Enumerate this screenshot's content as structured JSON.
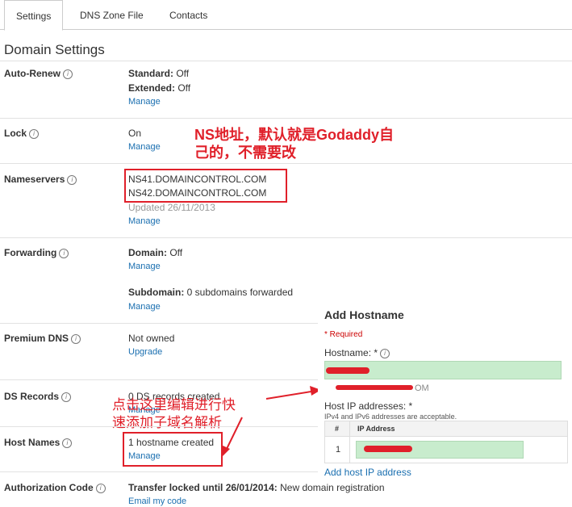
{
  "tabs": [
    "Settings",
    "DNS Zone File",
    "Contacts"
  ],
  "page_heading": "Domain Settings",
  "auto_renew": {
    "label": "Auto-Renew",
    "standard_label": "Standard:",
    "standard_value": " Off",
    "extended_label": "Extended:",
    "extended_value": " Off",
    "link": "Manage"
  },
  "lock": {
    "label": "Lock",
    "value": "On",
    "link": "Manage"
  },
  "nameservers": {
    "label": "Nameservers",
    "ns1": "NS41.DOMAINCONTROL.COM",
    "ns2": "NS42.DOMAINCONTROL.COM",
    "updated": "Updated 26/11/2013",
    "link": "Manage"
  },
  "forwarding": {
    "label": "Forwarding",
    "domain_label": "Domain:",
    "domain_value": " Off",
    "link1": "Manage",
    "subdomain_label": "Subdomain:",
    "subdomain_value": " 0 subdomains forwarded",
    "link2": "Manage"
  },
  "premium_dns": {
    "label": "Premium DNS",
    "value": "Not owned",
    "link": "Upgrade"
  },
  "ds_records": {
    "label": "DS Records",
    "value": "0 DS records created",
    "link": "Manage"
  },
  "host_names": {
    "label": "Host Names",
    "value": "1 hostname created",
    "link": "Manage"
  },
  "authorization": {
    "label": "Authorization Code",
    "value_bold": "Transfer locked until 26/01/2014:",
    "value_rest": " New domain registration",
    "link": "Email my code"
  },
  "annotations": {
    "ns_note_line1": "NS地址，默认就是Godaddy自",
    "ns_note_line2": "己的，不需要改",
    "host_note_line1": "点击这里编辑进行快",
    "host_note_line2": "速添加子域名解析"
  },
  "add_hostname": {
    "title": "Add Hostname",
    "required": "* Required",
    "hostname_label": "Hostname: *",
    "suffix_hint": "OM",
    "ip_label": "Host IP addresses: *",
    "ip_hint": "IPv4 and IPv6 addresses are acceptable.",
    "col_num": "#",
    "col_ip": "IP Address",
    "row_num": "1",
    "add_link": "Add host IP address"
  },
  "colors": {
    "accent_red": "#e0202a",
    "link_blue": "#1a6fb0",
    "field_green": "#c8eccd"
  }
}
